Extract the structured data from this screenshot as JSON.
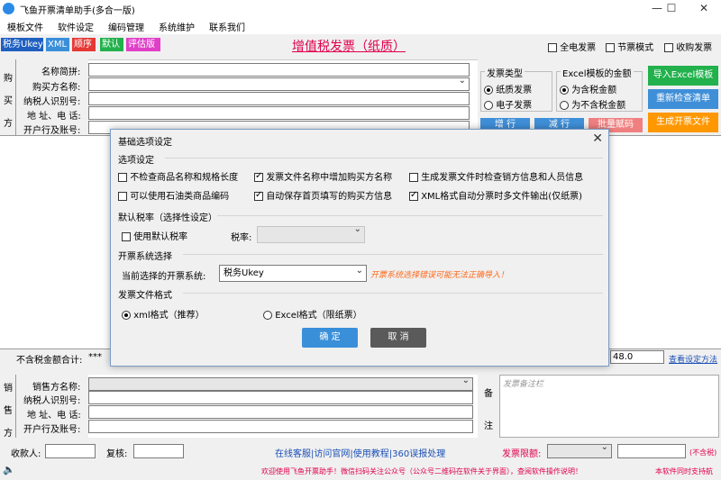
{
  "window": {
    "title": "飞鱼开票清单助手(多合一版)",
    "minimize": "—",
    "maximize": "☐",
    "close": "✕"
  },
  "menu": [
    "模板文件",
    "软件设定",
    "编码管理",
    "系统维护",
    "联系我们"
  ],
  "tags": {
    "ukey": "税务Ukey",
    "xml": "XML",
    "order": "顺序",
    "default": "默认",
    "eval": "评估版"
  },
  "heading": "增值税发票（纸质）",
  "top_checks": {
    "full_elec": "全电发票",
    "save": "节票模式",
    "recv": "收购发票"
  },
  "buyer": {
    "side_label": [
      "购",
      "买",
      "方"
    ],
    "name_label": "名称简拼:",
    "buyer_name_label": "购买方名称:",
    "tax_label": "纳税人识别号:",
    "addr_label": "地 址、电 话:",
    "bank_label": "开户行及账号:"
  },
  "invoice_type": {
    "title": "发票类型",
    "paper": "纸质发票",
    "electronic": "电子发票"
  },
  "excel_amount": {
    "title": "Excel模板的金额",
    "incl": "为含税金额",
    "excl": "为不含税金额"
  },
  "right_buttons": {
    "import": "导入Excel模板",
    "recheck": "重新检查清单",
    "generate": "生成开票文件",
    "add_row": "增 行",
    "del_row": "减 行",
    "batch": "批量赋码"
  },
  "colors": {
    "green": "#22b14c",
    "blue": "#3f8fd8",
    "orange": "#ff9800",
    "pink": "#f08080",
    "red": "#e0004d",
    "teal": "#00a0a0",
    "dlg_blue": "#3a8fd9",
    "dlg_gray": "#5a5a5a"
  },
  "dialog": {
    "title": "基础选项设定",
    "close": "✕",
    "options_section": "选项设定",
    "opt1": "不检查商品名称和规格长度",
    "opt2": "发票文件名称中增加购买方名称",
    "opt3": "生成发票文件时检查销方信息和人员信息",
    "opt4": "可以使用石油类商品编码",
    "opt5": "自动保存首页填写的购买方信息",
    "opt6": "XML格式自动分票时多文件输出(仅纸票)",
    "tax_section": "默认税率（选择性设定）",
    "use_default_tax": "使用默认税率",
    "tax_rate_label": "税率:",
    "system_section": "开票系统选择",
    "current_system_label": "当前选择的开票系统:",
    "current_system_value": "税务Ukey",
    "warning": "开票系统选择错误可能无法正确导入！",
    "format_section": "发票文件格式",
    "xml_format": "xml格式（推荐）",
    "excel_format": "Excel格式（限纸票）",
    "ok": "确 定",
    "cancel": "取 消"
  },
  "totals": {
    "label": "不含税金额合计:",
    "value": "***",
    "rate_value": "48.0",
    "rate_link": "查看设定方法"
  },
  "seller": {
    "side_label": [
      "销",
      "售",
      "方"
    ],
    "name_label": "销售方名称:",
    "tax_label": "纳税人识别号:",
    "addr_label": "地 址、电 话:",
    "bank_label": "开户行及账号:",
    "notes_side": [
      "备",
      "注"
    ],
    "notes_placeholder": "发票备注栏"
  },
  "footer": {
    "payee_label": "收款人:",
    "reviewer_label": "复核:",
    "links": "在线客服|访问官网|使用教程|360误报处理",
    "limit_label": "发票限额:",
    "limit_note": "(不含税)",
    "welcome": "欢迎使用飞鱼开票助手！微信扫码关注公众号（公众号二维码在软件关于界面），查阅软件操作说明！",
    "update": "本软件同时支持航"
  }
}
